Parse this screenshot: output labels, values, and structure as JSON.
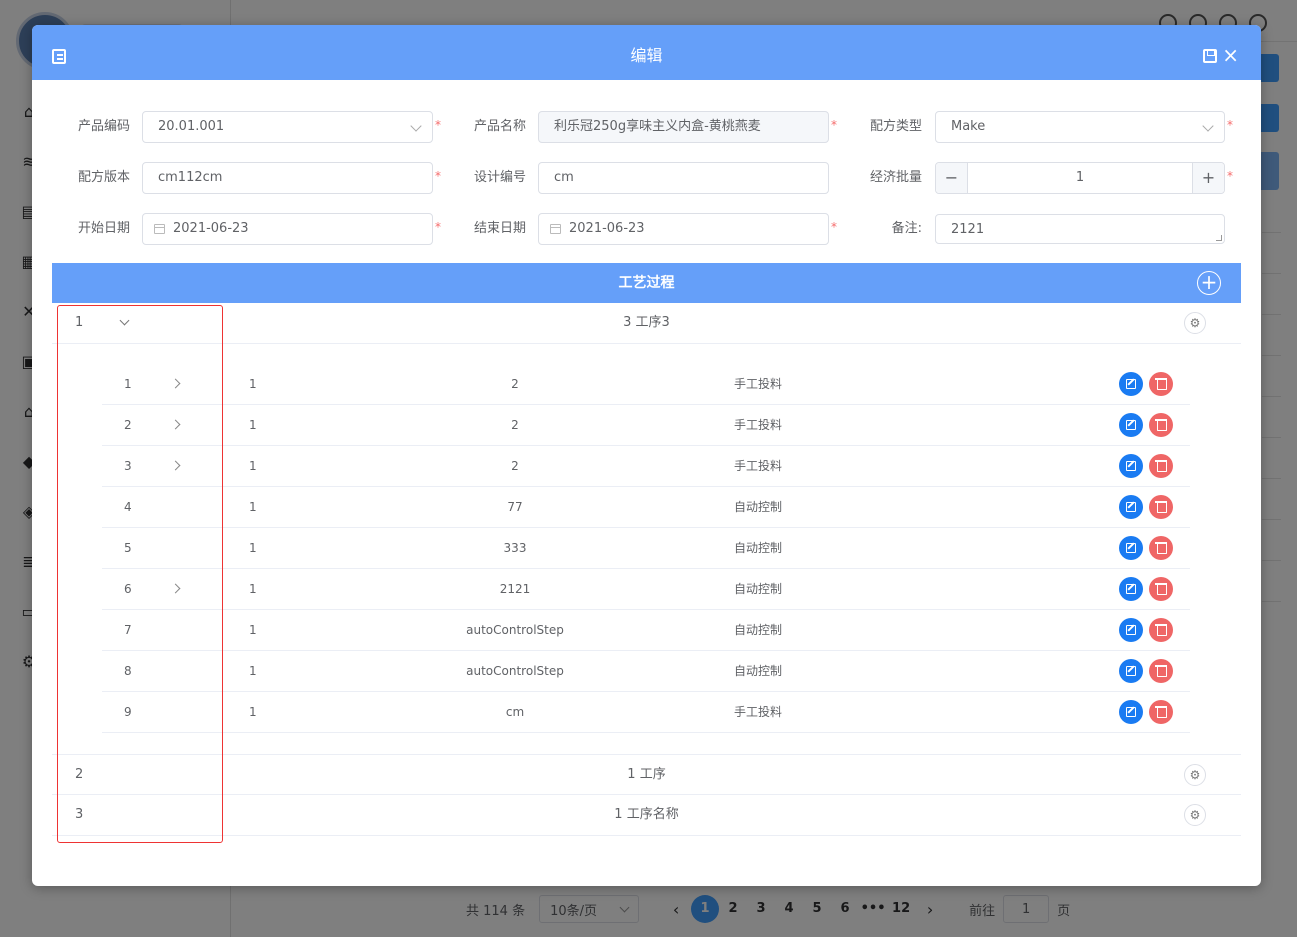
{
  "dialog": {
    "title": "编辑",
    "close_glyph": "×"
  },
  "form": {
    "product_code": {
      "label": "产品编码",
      "value": "20.01.001",
      "required": "*"
    },
    "product_name": {
      "label": "产品名称",
      "value": "利乐冠250g享味主义内盒-黄桃燕麦",
      "required": "*"
    },
    "recipe_type": {
      "label": "配方类型",
      "value": "Make",
      "required": "*"
    },
    "recipe_version": {
      "label": "配方版本",
      "value": "cm112cm",
      "required": "*"
    },
    "design_number": {
      "label": "设计编号",
      "value": "cm"
    },
    "economic_batch": {
      "label": "经济批量",
      "value": "1",
      "minus": "−",
      "plus": "+",
      "required": "*"
    },
    "start_date": {
      "label": "开始日期",
      "value": "2021-06-23",
      "required": "*"
    },
    "end_date": {
      "label": "结束日期",
      "value": "2021-06-23",
      "required": "*"
    },
    "remark": {
      "label": "备注:",
      "value": "2121"
    }
  },
  "process": {
    "title": "工艺过程",
    "add_glyph": "+",
    "gear_glyph": "⚙",
    "rows": [
      {
        "num": "1",
        "name": "3 工序3"
      },
      {
        "num": "2",
        "name": "1 工序"
      },
      {
        "num": "3",
        "name": "1 工序名称"
      }
    ],
    "steps": [
      {
        "num": "1",
        "qty": "1",
        "value": "2",
        "type": "手工投料"
      },
      {
        "num": "2",
        "qty": "1",
        "value": "2",
        "type": "手工投料"
      },
      {
        "num": "3",
        "qty": "1",
        "value": "2",
        "type": "手工投料"
      },
      {
        "num": "4",
        "qty": "1",
        "value": "77",
        "type": "自动控制"
      },
      {
        "num": "5",
        "qty": "1",
        "value": "333",
        "type": "自动控制"
      },
      {
        "num": "6",
        "qty": "1",
        "value": "2121",
        "type": "自动控制"
      },
      {
        "num": "7",
        "qty": "1",
        "value": "autoControlStep",
        "type": "自动控制"
      },
      {
        "num": "8",
        "qty": "1",
        "value": "autoControlStep",
        "type": "自动控制"
      },
      {
        "num": "9",
        "qty": "1",
        "value": "cm",
        "type": "手工投料"
      }
    ]
  },
  "pager": {
    "total": "共 114 条",
    "page_size": "10条/页",
    "prev": "‹",
    "next": "›",
    "pages": [
      "1",
      "2",
      "3",
      "4",
      "5",
      "6",
      "•••",
      "12"
    ],
    "goto_label": "前往",
    "goto_value": "1",
    "page_suffix": "页"
  }
}
